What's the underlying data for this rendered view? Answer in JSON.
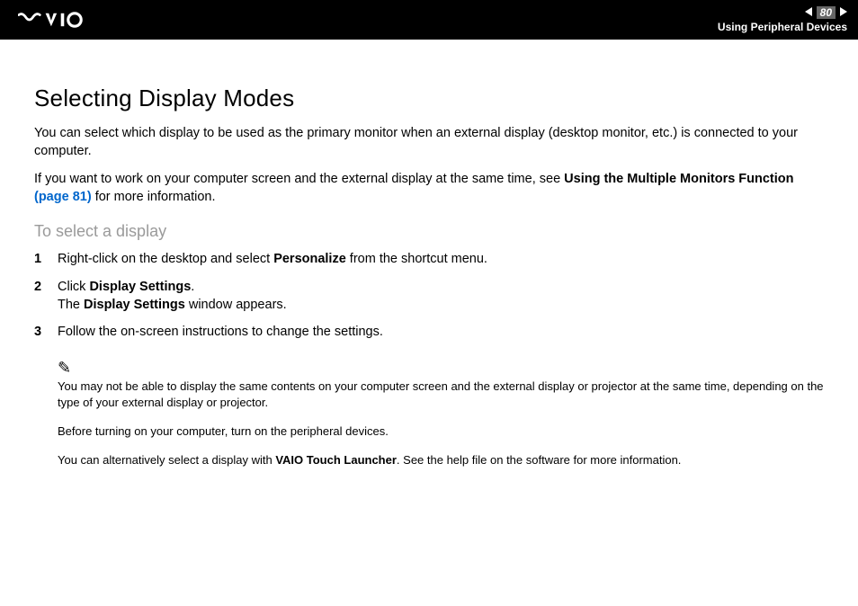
{
  "header": {
    "logo_alt": "VAIO",
    "page_number": "80",
    "section": "Using Peripheral Devices"
  },
  "content": {
    "title": "Selecting Display Modes",
    "para1": "You can select which display to be used as the primary monitor when an external display (desktop monitor, etc.) is connected to your computer.",
    "para2_pre": "If you want to work on your computer screen and the external display at the same time, see ",
    "para2_bold": "Using the Multiple Monitors Function ",
    "para2_link": "(page 81)",
    "para2_post": " for more information.",
    "subhead": "To select a display",
    "steps": [
      {
        "num": "1",
        "parts": [
          {
            "t": "Right-click on the desktop and select ",
            "b": false
          },
          {
            "t": "Personalize",
            "b": true
          },
          {
            "t": " from the shortcut menu.",
            "b": false
          }
        ]
      },
      {
        "num": "2",
        "parts": [
          {
            "t": "Click ",
            "b": false
          },
          {
            "t": "Display Settings",
            "b": true
          },
          {
            "t": ".",
            "b": false
          },
          {
            "t": "\n",
            "b": false
          },
          {
            "t": "The ",
            "b": false
          },
          {
            "t": "Display Settings",
            "b": true
          },
          {
            "t": " window appears.",
            "b": false
          }
        ]
      },
      {
        "num": "3",
        "parts": [
          {
            "t": "Follow the on-screen instructions to change the settings.",
            "b": false
          }
        ]
      }
    ],
    "note_icon": "✎",
    "note1": "You may not be able to display the same contents on your computer screen and the external display or projector at the same time, depending on the type of your external display or projector.",
    "note2": "Before turning on your computer, turn on the peripheral devices.",
    "note3_pre": "You can alternatively select a display with ",
    "note3_bold": "VAIO Touch Launcher",
    "note3_post": ". See the help file on the software for more information."
  }
}
